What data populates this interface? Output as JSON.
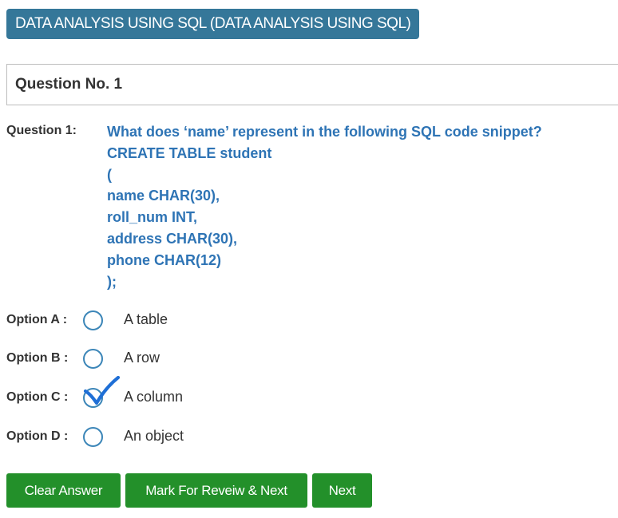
{
  "header": {
    "course_title": "DATA ANALYSIS USING SQL (DATA ANALYSIS USING SQL)"
  },
  "question_panel": {
    "title": "Question No. 1"
  },
  "question": {
    "label": "Question 1:",
    "lines": [
      "What does ‘name’ represent in the following SQL code snippet?",
      "CREATE TABLE student",
      "(",
      "name CHAR(30),",
      "roll_num INT,",
      "address CHAR(30),",
      "phone CHAR(12)",
      ");"
    ]
  },
  "options": [
    {
      "label": "Option A :",
      "text": "A table",
      "selected": false
    },
    {
      "label": "Option B :",
      "text": "A row",
      "selected": false
    },
    {
      "label": "Option C :",
      "text": "A column",
      "selected": true
    },
    {
      "label": "Option D :",
      "text": "An object",
      "selected": false
    }
  ],
  "buttons": {
    "clear": "Clear Answer",
    "mark": "Mark For Reveiw & Next",
    "next": "Next"
  },
  "colors": {
    "badge": "#357799",
    "question_text": "#2e74b5",
    "radio_border": "#3c86b8",
    "check_mark": "#1f6fd6",
    "button": "#23902a"
  }
}
